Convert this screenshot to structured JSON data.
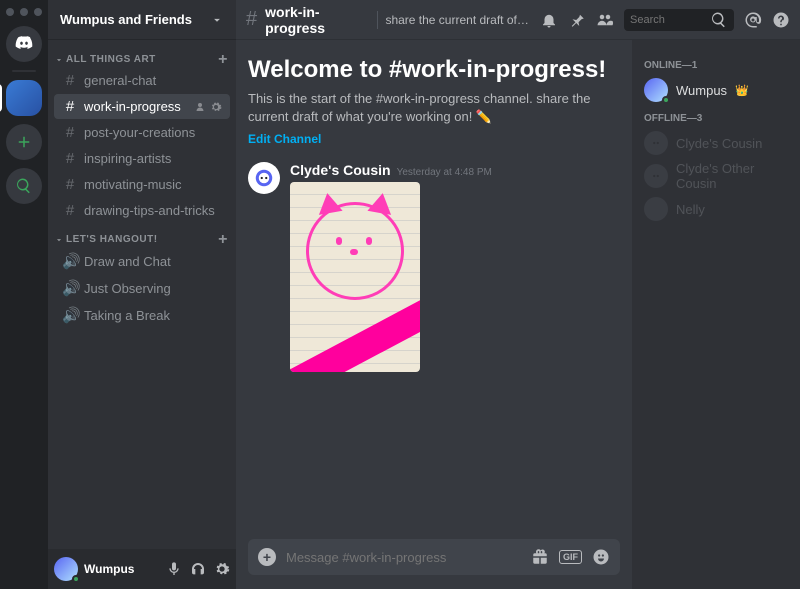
{
  "server": {
    "name": "Wumpus and Friends"
  },
  "categories": [
    {
      "name": "ALL THINGS ART",
      "channels": [
        {
          "type": "text",
          "name": "general-chat"
        },
        {
          "type": "text",
          "name": "work-in-progress",
          "active": true
        },
        {
          "type": "text",
          "name": "post-your-creations"
        },
        {
          "type": "text",
          "name": "inspiring-artists"
        },
        {
          "type": "text",
          "name": "motivating-music"
        },
        {
          "type": "text",
          "name": "drawing-tips-and-tricks"
        }
      ]
    },
    {
      "name": "LET'S HANGOUT!",
      "channels": [
        {
          "type": "voice",
          "name": "Draw and Chat"
        },
        {
          "type": "voice",
          "name": "Just Observing"
        },
        {
          "type": "voice",
          "name": "Taking a Break"
        }
      ]
    }
  ],
  "current_user": {
    "name": "Wumpus"
  },
  "channel_header": {
    "name": "work-in-progress",
    "topic": "share the current draft of wh…",
    "search_placeholder": "Search"
  },
  "welcome": {
    "heading": "Welcome to #work-in-progress!",
    "body": "This is the start of the #work-in-progress channel. share the current draft of what you're working on! ✏️",
    "edit_link": "Edit Channel"
  },
  "message": {
    "author": "Clyde's Cousin",
    "timestamp": "Yesterday at 4:48 PM"
  },
  "composer": {
    "placeholder": "Message #work-in-progress",
    "gif_label": "GIF"
  },
  "members": {
    "online_header": "ONLINE—1",
    "offline_header": "OFFLINE—3",
    "online": [
      {
        "name": "Wumpus",
        "crown": "👑",
        "color": "#5865f2"
      }
    ],
    "offline": [
      {
        "name": "Clyde's Cousin",
        "color": "#4f545c"
      },
      {
        "name": "Clyde's Other Cousin",
        "color": "#4f545c"
      },
      {
        "name": "Nelly",
        "color": "#4f545c"
      }
    ]
  }
}
